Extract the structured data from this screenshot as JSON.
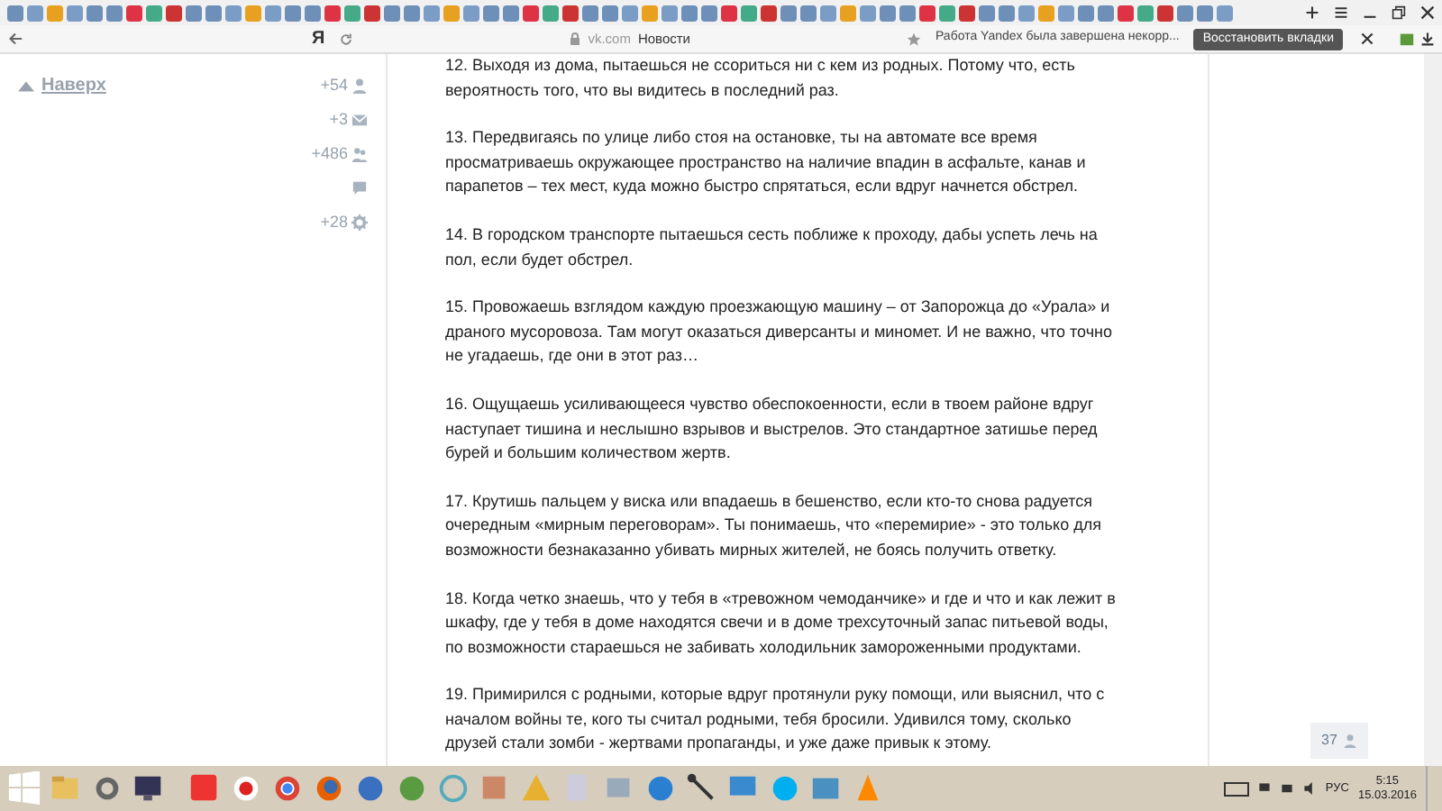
{
  "browser": {
    "logo": "Я",
    "domain": "vk.com",
    "page_title": "Новости",
    "notification": {
      "message": "Работа Yandex была завершена некорр...",
      "button": "Восстановить вкладки"
    }
  },
  "sidebar": {
    "top_link": "Наверх",
    "counters": [
      {
        "kind": "friends",
        "value": "+54"
      },
      {
        "kind": "messages",
        "value": "+3"
      },
      {
        "kind": "groups",
        "value": "+486"
      },
      {
        "kind": "comments"
      },
      {
        "kind": "settings",
        "value": "+28"
      }
    ]
  },
  "post": {
    "paragraphs": [
      "12. Выходя из дома, пытаешься не ссориться ни с кем из родных. Потому что, есть вероятность того, что вы видитесь в последний раз.",
      "13. Передвигаясь по улице либо стоя на остановке, ты на автомате все время просматриваешь окружающее пространство на наличие впадин в асфальте, канав и парапетов – тех мест, куда можно быстро спрятаться, если вдруг начнется обстрел.",
      "14. В городском транспорте пытаешься сесть поближе к проходу, дабы успеть лечь на пол, если будет обстрел.",
      "15. Провожаешь взглядом каждую проезжающую машину – от Запорожца до «Урала» и драного мусоровоза. Там могут оказаться диверсанты и миномет. И не важно, что точно не угадаешь, где они в этот раз…",
      "16. Ощущаешь усиливающееся чувство обеспокоенности, если в твоем районе вдруг наступает тишина и неслышно взрывов и выстрелов. Это стандартное затишье перед бурей и большим количеством жертв.",
      "17. Крутишь пальцем у виска или впадаешь в бешенство, если кто-то снова радуется очередным «мирным переговорам». Ты понимаешь, что «перемирие» - это только для возможности безнаказанно убивать мирных жителей, не боясь получить ответку.",
      "18. Когда четко знаешь, что у тебя в «тревожном чемоданчике» и где и что и как лежит в шкафу, где у тебя в доме находятся свечи и в доме трехсуточный запас питьевой воды, по возможности стараешься не забивать холодильник замороженными продуктами.",
      "19. Примирился с родными, которые вдруг протянули руку помощи, или выяснил, что с началом войны те, кого ты считал родными, тебя бросили. Удивился тому, сколько друзей стали зомби - жертвами пропаганды, и уже даже привык к этому."
    ]
  },
  "online_friends": {
    "count": "37"
  },
  "taskbar": {
    "language": "РУС",
    "time": "5:15",
    "date": "15.03.2016"
  }
}
